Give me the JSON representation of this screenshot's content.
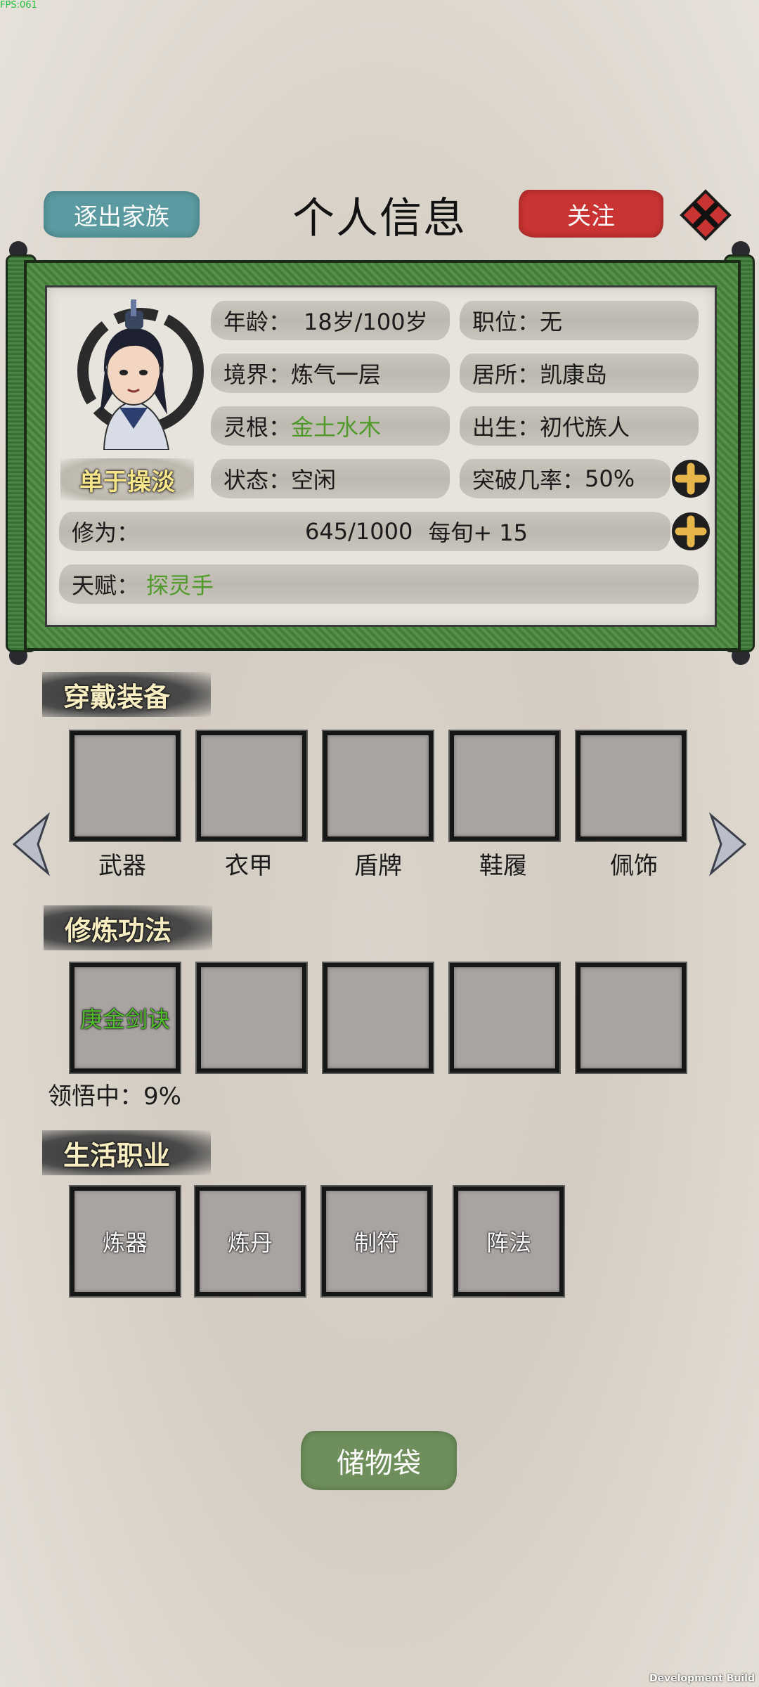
{
  "debug": {
    "fps": "FPS:061",
    "build": "Development Build"
  },
  "header": {
    "title": "个人信息",
    "expel_label": "逐出家族",
    "follow_label": "关注",
    "close_icon": "close-x-icon"
  },
  "profile": {
    "name": "单于操淡",
    "age_label": "年龄：",
    "age_value": "18岁/100岁",
    "position_label": "职位：",
    "position_value": "无",
    "realm_label": "境界：",
    "realm_value": "炼气一层",
    "residence_label": "居所：",
    "residence_value": "凯康岛",
    "root_label": "灵根：",
    "root_value": "金土水木",
    "birth_label": "出生：",
    "birth_value": "初代族人",
    "status_label": "状态：",
    "status_value": "空闲",
    "breakthrough_label": "突破几率：",
    "breakthrough_value": "50%",
    "cultivation_label": "修为：",
    "cultivation_value": "645/1000",
    "cultivation_rate": "每旬+ 15",
    "talent_label": "天赋：",
    "talent_value": "探灵手",
    "accent_green": "#4f9a2a"
  },
  "equipment": {
    "title": "穿戴装备",
    "slots": [
      "武器",
      "衣甲",
      "盾牌",
      "鞋履",
      "佩饰"
    ]
  },
  "techniques": {
    "title": "修炼功法",
    "slots": [
      "庚金剑诀",
      "",
      "",
      "",
      ""
    ],
    "progress_text": "领悟中：9%"
  },
  "professions": {
    "title": "生活职业",
    "slots": [
      "炼器",
      "炼丹",
      "制符",
      "阵法"
    ]
  },
  "storage": {
    "label": "储物袋"
  }
}
